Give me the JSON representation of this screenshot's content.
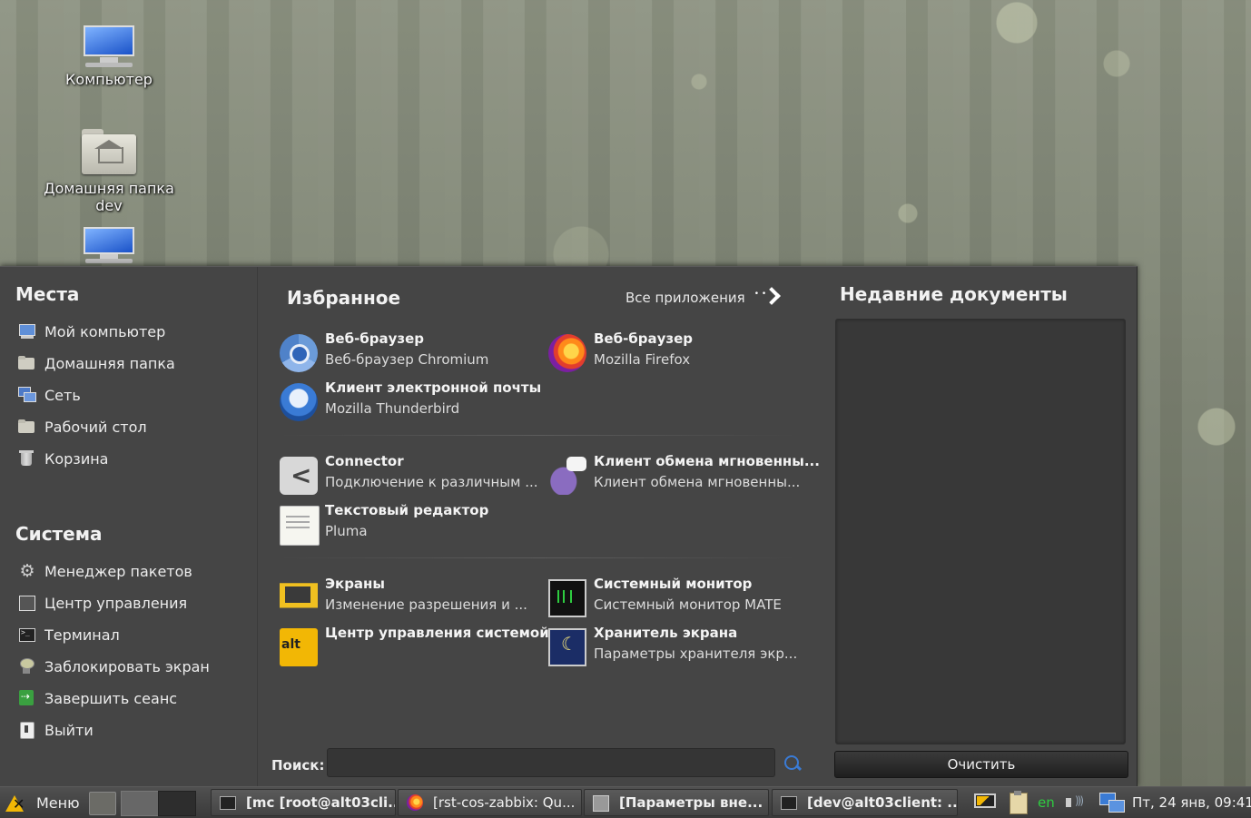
{
  "desktop": {
    "icons": [
      {
        "label": "Компьютер",
        "icon": "computer-icon"
      },
      {
        "label": "Домашняя папка dev",
        "icon": "home-folder-icon"
      },
      {
        "label": "",
        "icon": "network-icon"
      }
    ]
  },
  "menu": {
    "places": {
      "title": "Места",
      "items": [
        {
          "label": "Мой компьютер",
          "icon": "computer-icon"
        },
        {
          "label": "Домашняя папка",
          "icon": "home-folder-icon"
        },
        {
          "label": "Сеть",
          "icon": "network-icon"
        },
        {
          "label": "Рабочий стол",
          "icon": "desktop-folder-icon"
        },
        {
          "label": "Корзина",
          "icon": "trash-icon"
        }
      ]
    },
    "system": {
      "title": "Система",
      "items": [
        {
          "label": "Менеджер пакетов",
          "icon": "gear-icon"
        },
        {
          "label": "Центр управления",
          "icon": "control-center-icon"
        },
        {
          "label": "Терминал",
          "icon": "terminal-icon"
        },
        {
          "label": "Заблокировать экран",
          "icon": "lock-screen-icon"
        },
        {
          "label": "Завершить сеанс",
          "icon": "logout-icon"
        },
        {
          "label": "Выйти",
          "icon": "quit-icon"
        }
      ]
    },
    "favorites": {
      "title": "Избранное",
      "all_apps_label": "Все приложения",
      "apps": [
        {
          "title": "Веб-браузер",
          "subtitle": "Веб-браузер Chromium",
          "icon": "chromium-icon"
        },
        {
          "title": "Веб-браузер",
          "subtitle": "Mozilla Firefox",
          "icon": "firefox-icon"
        },
        {
          "title": "Клиент электронной почты",
          "subtitle": "Mozilla Thunderbird",
          "icon": "thunderbird-icon"
        },
        {
          "title": "Connector",
          "subtitle": "Подключение к различным ...",
          "icon": "connector-icon"
        },
        {
          "title": "Клиент обмена мгновенны...",
          "subtitle": "Клиент обмена мгновенны...",
          "icon": "pidgin-icon"
        },
        {
          "title": "Текстовый редактор",
          "subtitle": "Pluma",
          "icon": "text-editor-icon"
        },
        {
          "title": "Экраны",
          "subtitle": "Изменение разрешения и ...",
          "icon": "displays-icon"
        },
        {
          "title": "Системный монитор",
          "subtitle": "Системный монитор MATE",
          "icon": "system-monitor-icon"
        },
        {
          "title": "Центр управления системой",
          "subtitle": "",
          "icon": "alt-control-center-icon"
        },
        {
          "title": "Хранитель экрана",
          "subtitle": "Параметры хранителя экр...",
          "icon": "screensaver-icon"
        }
      ]
    },
    "recent": {
      "title": "Недавние документы",
      "clear_label": "Очистить"
    },
    "search": {
      "label": "Поиск:",
      "value": "",
      "placeholder": ""
    }
  },
  "taskbar": {
    "menu_label": "Меню",
    "tasks": [
      {
        "label": "[mc [root@alt03cli...",
        "icon": "terminal-icon"
      },
      {
        "label": "[rst-cos-zabbix: Qu...",
        "icon": "firefox-icon"
      },
      {
        "label": "[Параметры вне...",
        "icon": "appearance-icon"
      },
      {
        "label": "[dev@alt03client: ...",
        "icon": "terminal-icon"
      }
    ],
    "language": "en",
    "clock": "Пт, 24 янв, 09:41"
  },
  "colors": {
    "menu_bg": "#454545",
    "taskbar_bg": "#444444",
    "accent_yellow": "#f2b705",
    "lang_green": "#2ecc40"
  }
}
